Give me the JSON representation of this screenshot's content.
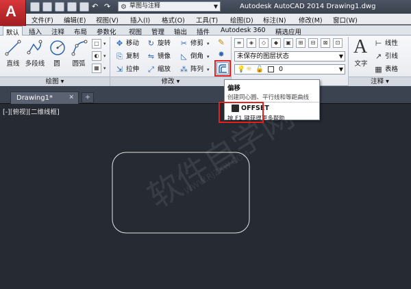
{
  "app": {
    "logo_text": "A",
    "workspace": "草图与注释",
    "title": "Autodesk AutoCAD 2014    Drawing1.dwg"
  },
  "menubar": [
    "文件(F)",
    "编辑(E)",
    "视图(V)",
    "插入(I)",
    "格式(O)",
    "工具(T)",
    "绘图(D)",
    "标注(N)",
    "修改(M)",
    "窗口(W)"
  ],
  "ribbon_tabs": [
    "默认",
    "插入",
    "注释",
    "布局",
    "参数化",
    "视图",
    "管理",
    "输出",
    "插件",
    "Autodesk 360",
    "精选应用"
  ],
  "draw_panel": {
    "tools": [
      "直线",
      "多段线",
      "圆",
      "圆弧"
    ],
    "label": "绘图"
  },
  "modify_panel": {
    "row1": [
      "移动",
      "旋转",
      "修剪"
    ],
    "row2": [
      "复制",
      "镜像",
      "倒角"
    ],
    "row3": [
      "拉伸",
      "缩放",
      "阵列"
    ],
    "label": "修改"
  },
  "layers_panel": {
    "layer_state": "未保存的图层状态",
    "current_layer": "0"
  },
  "annotation_panel": {
    "text_label": "文字",
    "items": [
      "线性",
      "引线",
      "表格"
    ],
    "label": "注释"
  },
  "tooltip": {
    "title": "偏移",
    "description": "创建同心圆、平行线和等距曲线",
    "command": "OFFSET",
    "help": "按 F1 键获得更多帮助"
  },
  "file_tab": {
    "name": "Drawing1*"
  },
  "viewport": {
    "label": "[-][俯视][二维线框]"
  },
  "watermark": {
    "main": "软件自学网",
    "sub": "WWW.RJZXW.COM"
  },
  "colors": {
    "canvas": "#252a33",
    "highlight": "#e5211d",
    "logo": "#c52a2d"
  }
}
